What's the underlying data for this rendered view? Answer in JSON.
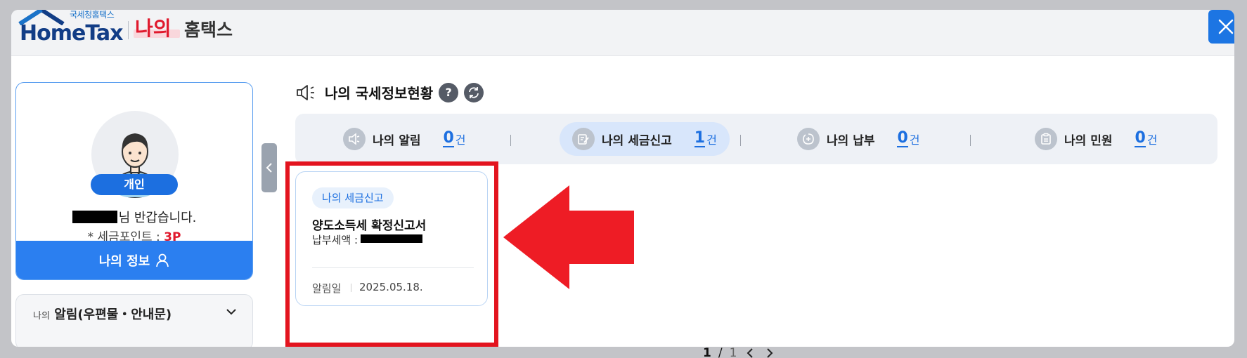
{
  "header": {
    "logo_sub": "국세청홈택스",
    "logo_main": "HomeTax",
    "title_my": "나의",
    "title_rest": "홈택스"
  },
  "profile": {
    "type_badge": "개인",
    "greeting_suffix": "님 반갑습니다.",
    "points_label": "* 세금포인트 :",
    "points_value": "3P",
    "my_info_button": "나의 정보"
  },
  "notice_panel": {
    "title_small": "나의",
    "title_main": "알림(우편물・안내문)"
  },
  "section": {
    "title": "나의 국세정보현황"
  },
  "status_items": [
    {
      "label": "나의 알림",
      "count": "0",
      "unit": "건",
      "icon": "megaphone-icon"
    },
    {
      "label": "나의 세금신고",
      "count": "1",
      "unit": "건",
      "icon": "edit-document-icon"
    },
    {
      "label": "나의 납부",
      "count": "0",
      "unit": "건",
      "icon": "payment-icon"
    },
    {
      "label": "나의 민원",
      "count": "0",
      "unit": "건",
      "icon": "clipboard-icon"
    }
  ],
  "card": {
    "tag": "나의 세금신고",
    "title": "양도소득세 확정신고서",
    "sub_label": "납부세액 :",
    "date_label": "알림일",
    "date": "2025.05.18."
  },
  "pagination": {
    "current": "1",
    "total": "1"
  },
  "colors": {
    "brand_blue": "#1c6fe0",
    "accent_red": "#e0192d",
    "highlight_red": "#e3141f"
  }
}
